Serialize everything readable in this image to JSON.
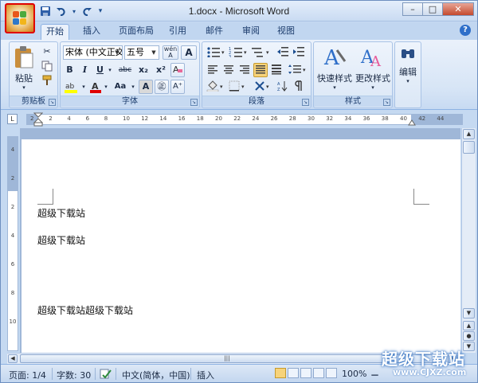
{
  "window": {
    "title": "1.docx - Microsoft Word",
    "controls": {
      "minimize": "–",
      "maximize": "□",
      "close": "✕"
    }
  },
  "quick_access": {
    "save_icon": "save-icon",
    "undo_icon": "undo-icon",
    "redo_icon": "redo-icon",
    "customize": "▾"
  },
  "tabs": [
    {
      "label": "开始",
      "active": true
    },
    {
      "label": "插入"
    },
    {
      "label": "页面布局"
    },
    {
      "label": "引用"
    },
    {
      "label": "邮件"
    },
    {
      "label": "审阅"
    },
    {
      "label": "视图"
    }
  ],
  "ribbon": {
    "clipboard": {
      "paste_label": "粘贴",
      "group_label": "剪贴板"
    },
    "font": {
      "font_name": "宋体 (中文正文)",
      "font_size": "五号",
      "group_label": "字体",
      "bold": "B",
      "italic": "I",
      "underline": "U",
      "strike": "abc",
      "subscript": "x₂",
      "superscript": "x²",
      "change_case": "Aa",
      "clear": "A"
    },
    "paragraph": {
      "group_label": "段落"
    },
    "styles": {
      "quick_styles_label": "快速样式",
      "change_styles_label": "更改样式",
      "group_label": "样式"
    },
    "editing": {
      "label": "编辑"
    }
  },
  "ruler": {
    "ticks": [
      "2",
      "2",
      "4",
      "6",
      "8",
      "10",
      "12",
      "14",
      "16",
      "18",
      "20",
      "22",
      "24",
      "26",
      "28",
      "30",
      "32",
      "34",
      "36",
      "38",
      "40",
      "42",
      "44"
    ],
    "vticks": [
      "4",
      "2",
      "2",
      "4",
      "6",
      "8",
      "10"
    ]
  },
  "document": {
    "paragraphs": [
      "超级下载站",
      "超级下载站",
      "超级下载站超级下载站"
    ]
  },
  "status": {
    "page": "页面: 1/4",
    "words": "字数: 30",
    "language": "中文(简体，中国)",
    "mode": "插入",
    "zoom": "100%"
  },
  "watermark": {
    "title": "超级下载站",
    "url": "www.CJXZ.com"
  },
  "colors": {
    "highlight": "#ffff00",
    "font_color": "#e00000",
    "office_border": "#e00000"
  }
}
